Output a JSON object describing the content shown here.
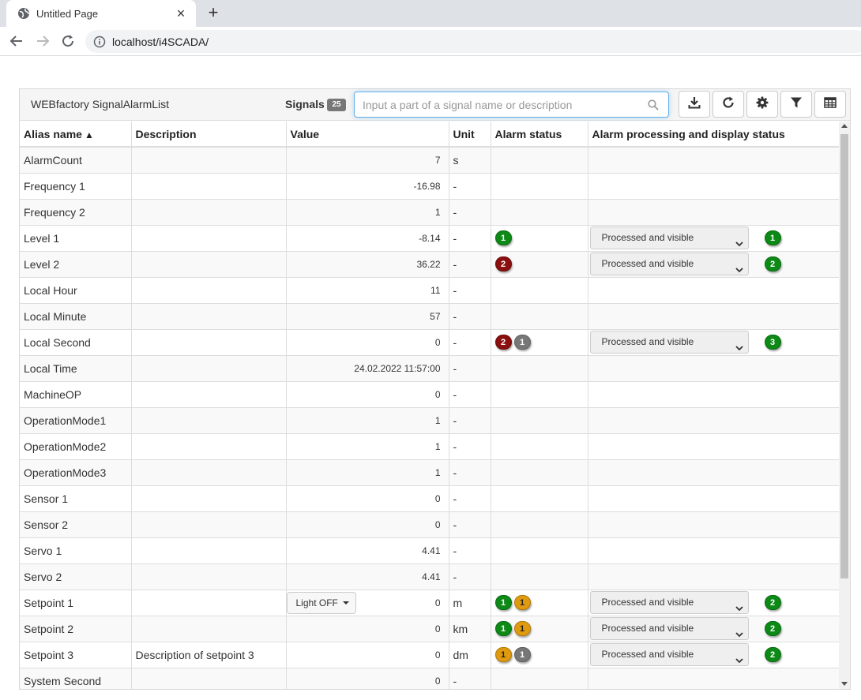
{
  "browser": {
    "tab_title": "Untitled Page",
    "url": "localhost/i4SCADA/"
  },
  "widget": {
    "title": "WEBfactory SignalAlarmList",
    "signals_label": "Signals",
    "signals_count": "25",
    "search_placeholder": "Input a part of a signal name or description"
  },
  "columns": {
    "alias": "Alias name",
    "description": "Description",
    "value": "Value",
    "unit": "Unit",
    "alarm_status": "Alarm status",
    "processing": "Alarm processing and display status"
  },
  "rows": [
    {
      "alias": "AlarmCount",
      "description": "",
      "value": "7",
      "unit": "s",
      "alarms": [],
      "processing": null
    },
    {
      "alias": "Frequency 1",
      "description": "",
      "value": "-16.98",
      "unit": "-",
      "alarms": [],
      "processing": null
    },
    {
      "alias": "Frequency 2",
      "description": "",
      "value": "1",
      "unit": "-",
      "alarms": [],
      "processing": null
    },
    {
      "alias": "Level 1",
      "description": "",
      "value": "-8.14",
      "unit": "-",
      "alarms": [
        {
          "count": "1",
          "color": "green"
        }
      ],
      "processing": {
        "label": "Processed and visible",
        "count": "1"
      }
    },
    {
      "alias": "Level 2",
      "description": "",
      "value": "36.22",
      "unit": "-",
      "alarms": [
        {
          "count": "2",
          "color": "red"
        }
      ],
      "processing": {
        "label": "Processed and visible",
        "count": "2"
      }
    },
    {
      "alias": "Local Hour",
      "description": "",
      "value": "11",
      "unit": "-",
      "alarms": [],
      "processing": null
    },
    {
      "alias": "Local Minute",
      "description": "",
      "value": "57",
      "unit": "-",
      "alarms": [],
      "processing": null
    },
    {
      "alias": "Local Second",
      "description": "",
      "value": "0",
      "unit": "-",
      "alarms": [
        {
          "count": "2",
          "color": "red"
        },
        {
          "count": "1",
          "color": "gray"
        }
      ],
      "processing": {
        "label": "Processed and visible",
        "count": "3"
      }
    },
    {
      "alias": "Local Time",
      "description": "",
      "value": "24.02.2022 11:57:00",
      "unit": "-",
      "alarms": [],
      "processing": null
    },
    {
      "alias": "MachineOP",
      "description": "",
      "value": "0",
      "unit": "-",
      "alarms": [],
      "processing": null
    },
    {
      "alias": "OperationMode1",
      "description": "",
      "value": "1",
      "unit": "-",
      "alarms": [],
      "processing": null
    },
    {
      "alias": "OperationMode2",
      "description": "",
      "value": "1",
      "unit": "-",
      "alarms": [],
      "processing": null
    },
    {
      "alias": "OperationMode3",
      "description": "",
      "value": "1",
      "unit": "-",
      "alarms": [],
      "processing": null
    },
    {
      "alias": "Sensor 1",
      "description": "",
      "value": "0",
      "unit": "-",
      "alarms": [],
      "processing": null
    },
    {
      "alias": "Sensor 2",
      "description": "",
      "value": "0",
      "unit": "-",
      "alarms": [],
      "processing": null
    },
    {
      "alias": "Servo 1",
      "description": "",
      "value": "4.41",
      "unit": "-",
      "alarms": [],
      "processing": null
    },
    {
      "alias": "Servo 2",
      "description": "",
      "value": "4.41",
      "unit": "-",
      "alarms": [],
      "processing": null
    },
    {
      "alias": "Setpoint 1",
      "description": "",
      "value": "0",
      "unit": "m",
      "button": "Light OFF",
      "alarms": [
        {
          "count": "1",
          "color": "green"
        },
        {
          "count": "1",
          "color": "orange"
        }
      ],
      "processing": {
        "label": "Processed and visible",
        "count": "2"
      }
    },
    {
      "alias": "Setpoint 2",
      "description": "",
      "value": "0",
      "unit": "km",
      "alarms": [
        {
          "count": "1",
          "color": "green"
        },
        {
          "count": "1",
          "color": "orange"
        }
      ],
      "processing": {
        "label": "Processed and visible",
        "count": "2"
      }
    },
    {
      "alias": "Setpoint 3",
      "description": "Description of setpoint 3",
      "value": "0",
      "unit": "dm",
      "alarms": [
        {
          "count": "1",
          "color": "orange"
        },
        {
          "count": "1",
          "color": "gray"
        }
      ],
      "processing": {
        "label": "Processed and visible",
        "count": "2"
      }
    },
    {
      "alias": "System Second",
      "description": "",
      "value": "0",
      "unit": "-",
      "alarms": [],
      "processing": null
    }
  ],
  "colors": {
    "green": "#0d8a16",
    "red": "#8b0f0f",
    "orange": "#e09a10",
    "gray": "#777777",
    "focus": "#66afe9"
  },
  "icons": {
    "download": "download-icon",
    "refresh": "refresh-icon",
    "settings": "gear-icon",
    "filter": "filter-icon",
    "columns": "table-icon"
  }
}
